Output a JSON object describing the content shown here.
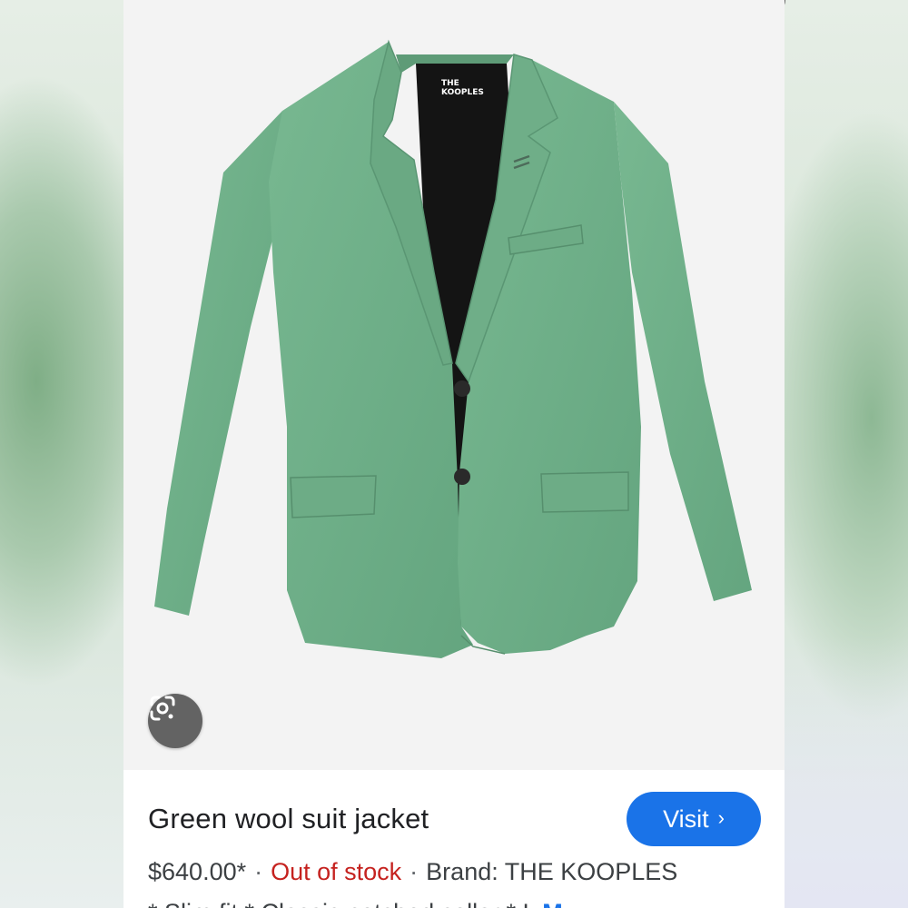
{
  "product": {
    "title": "Green wool suit jacket",
    "price": "$640.00*",
    "separator": "·",
    "stock_status": "Out of stock",
    "brand": "Brand: THE KOOPLES",
    "features": "* Slim fit * Classic notched collar * L",
    "more_label": "M",
    "label_text_line1": "THE",
    "label_text_line2": "KOOPLES"
  },
  "buttons": {
    "visit_label": "Visit",
    "visit_chevron": "›",
    "lens_icon": "google-lens-icon"
  },
  "colors": {
    "jacket": "#6fb08a",
    "accent": "#1a73e8",
    "out_of_stock": "#c5221f"
  }
}
